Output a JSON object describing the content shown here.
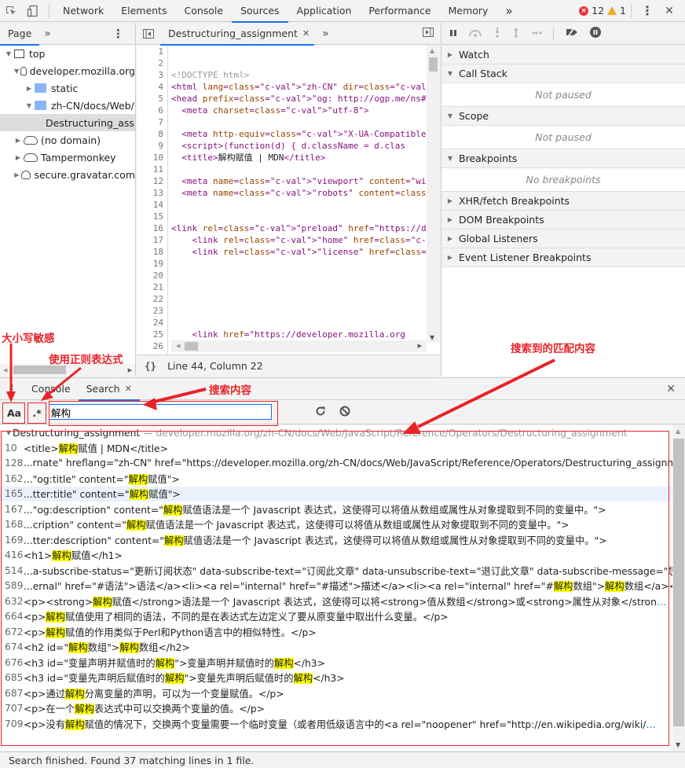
{
  "toolbar": {
    "tabs": [
      "Network",
      "Elements",
      "Console",
      "Sources",
      "Application",
      "Performance",
      "Memory"
    ],
    "active_tab": "Sources",
    "more_tabs_label": "»",
    "error_count": "12",
    "warning_count": "1",
    "close_label": "✕",
    "menu_label": "⋮"
  },
  "navigator": {
    "tab_label": "Page",
    "more_label": "»",
    "menu_label": "⋮",
    "tree": [
      {
        "label": "top",
        "icon": "frame-icon",
        "expanded": true
      },
      {
        "label": "developer.mozilla.org",
        "icon": "cloud-icon",
        "expanded": true
      },
      {
        "label": "static",
        "icon": "folder-icon",
        "expanded": false
      },
      {
        "label": "zh-CN/docs/Web/",
        "icon": "folder-icon",
        "expanded": true
      },
      {
        "label": "Destructuring_assignment",
        "icon": "file-icon",
        "selected": true
      },
      {
        "label": "(no domain)",
        "icon": "cloud-icon",
        "expanded": false
      },
      {
        "label": "Tampermonkey",
        "icon": "cloud-icon",
        "expanded": false
      },
      {
        "label": "secure.gravatar.com",
        "icon": "cloud-icon",
        "expanded": false
      }
    ]
  },
  "editor": {
    "tab_label": "Destructuring_assignment",
    "tab_close": "✕",
    "more_label": "»",
    "line_numbers": [
      "1",
      "2",
      "3",
      "4",
      "5",
      "6",
      "7",
      "8",
      "9",
      "10",
      "11",
      "12",
      "13",
      "14",
      "15",
      "16",
      "17",
      "18",
      "19",
      "20",
      "21",
      "22",
      "23",
      "24",
      "25",
      "26"
    ],
    "lines": [
      "",
      "",
      "<!DOCTYPE html>",
      "<html lang=\"zh-CN\" dir=\"ltr\" class=\"no-js\">",
      "<head prefix=\"og: http://ogp.me/ns#\">",
      "  <meta charset=\"utf-8\">",
      "",
      "  <meta http-equiv=\"X-UA-Compatible\" content=",
      "  <script>(function(d) { d.className = d.clas",
      "  <title>解构赋值 | MDN</title>",
      "",
      "  <meta name=\"viewport\" content=\"width=device",
      "  <meta name=\"robots\" content=\"index, follow\"",
      "",
      "",
      "<link rel=\"preload\" href=\"https://developer.m",
      "    <link rel=\"home\" href=\"/zh-CN/\">",
      "    <link rel=\"license\" href=\"#license\">",
      "",
      "",
      "",
      "",
      "",
      "",
      "    <link href=\"https://developer.mozilla.org",
      ""
    ],
    "status": "Line 44, Column 22",
    "format_label": "{}"
  },
  "debugger": {
    "sections": [
      {
        "label": "Watch",
        "expanded": false
      },
      {
        "label": "Call Stack",
        "expanded": true,
        "empty_text": "Not paused"
      },
      {
        "label": "Scope",
        "expanded": true,
        "empty_text": "Not paused"
      },
      {
        "label": "Breakpoints",
        "expanded": true,
        "empty_text": "No breakpoints"
      },
      {
        "label": "XHR/fetch Breakpoints",
        "expanded": false
      },
      {
        "label": "DOM Breakpoints",
        "expanded": false
      },
      {
        "label": "Global Listeners",
        "expanded": false
      },
      {
        "label": "Event Listener Breakpoints",
        "expanded": false
      }
    ]
  },
  "drawer": {
    "tabs": [
      "Console",
      "Search"
    ],
    "active_tab": "Search",
    "tab_close": "✕",
    "close_label": "✕",
    "drawer_menu": "⋮"
  },
  "search": {
    "case_label": "Aa",
    "regex_label": ".*",
    "query": "解构",
    "refresh_label": "↻",
    "clear_label": "⊘",
    "file_name": "Destructuring_assignment",
    "file_path": "— developer.mozilla.org/zh-CN/docs/Web/JavaScript/Reference/Operators/Destructuring_assignment",
    "results": [
      {
        "line": "10",
        "parts": [
          "<title>",
          "#解构",
          "赋值 | MDN</title>"
        ]
      },
      {
        "line": "128",
        "parts": [
          "...rnate\" hreflang=\"zh-CN\" href=\"https://developer.mozilla.org/zh-CN/docs/Web/JavaScript/Reference/Operators/Destructuring_assignme"
        ],
        "ellipsis": true
      },
      {
        "line": "162",
        "parts": [
          "...\"og:title\" content=\"",
          "#解构",
          "赋值\">"
        ]
      },
      {
        "line": "165",
        "parts": [
          "...tter:title\" content=\"",
          "#解构",
          "赋值\">"
        ],
        "highlighted": true
      },
      {
        "line": "167",
        "parts": [
          "...\"og:description\" content=\"",
          "#解构",
          "赋值语法是一个 Javascript 表达式，这使得可以将值从数组或属性从对象提取到不同的变量中。\">"
        ]
      },
      {
        "line": "168",
        "parts": [
          "...cription\" content=\"",
          "#解构",
          "赋值语法是一个 Javascript 表达式，这使得可以将值从数组或属性从对象提取到不同的变量中。\">"
        ]
      },
      {
        "line": "169",
        "parts": [
          "...tter:description\" content=\"",
          "#解构",
          "赋值语法是一个 Javascript 表达式，这使得可以将值从数组或属性从对象提取到不同的变量中。\">"
        ]
      },
      {
        "line": "416",
        "parts": [
          "<h1>",
          "#解构",
          "赋值</h1>"
        ]
      },
      {
        "line": "514",
        "parts": [
          "...a-subscribe-status=\"更新订阅状态\" data-subscribe-text=\"订阅此文章\" data-unsubscribe-text=\"退订此文章\" data-subscribe-message=\"您"
        ],
        "ellipsis": true
      },
      {
        "line": "589",
        "parts": [
          "...ernal\" href=\"#语法\">语法</a><li><a rel=\"internal\" href=\"#描述\">描述</a><li><a rel=\"internal\" href=\"#",
          "#解构",
          "数组\">",
          "#解构",
          "数组</a><li>"
        ],
        "ellipsis": true
      },
      {
        "line": "632",
        "parts": [
          "<p><strong>",
          "#解构",
          "赋值</strong>语法是一个 Javascript 表达式，这使得可以将<strong>值从数组</strong>或<strong>属性从对象</stron"
        ],
        "ellipsis": true
      },
      {
        "line": "664",
        "parts": [
          "<p>",
          "#解构",
          "赋值使用了相同的语法，不同的是在表达式左边定义了要从原变量中取出什么变量。</p>"
        ]
      },
      {
        "line": "672",
        "parts": [
          "<p>",
          "#解构",
          "赋值的作用类似于Perl和Python语言中的相似特性。</p>"
        ]
      },
      {
        "line": "674",
        "parts": [
          "<h2 id=\"",
          "#解构",
          "数组\">",
          "#解构",
          "数组</h2>"
        ]
      },
      {
        "line": "676",
        "parts": [
          "<h3 id=\"变量声明并赋值时的",
          "#解构",
          "\">变量声明并赋值时的",
          "#解构",
          "</h3>"
        ]
      },
      {
        "line": "685",
        "parts": [
          "<h3 id=\"变量先声明后赋值时的",
          "#解构",
          "\">变量先声明后赋值时的",
          "#解构",
          "</h3>"
        ]
      },
      {
        "line": "687",
        "parts": [
          "<p>通过",
          "#解构",
          "分离变量的声明，可以为一个变量赋值。</p>"
        ]
      },
      {
        "line": "707",
        "parts": [
          "<p>在一个",
          "#解构",
          "表达式中可以交换两个变量的值。</p>"
        ]
      },
      {
        "line": "709",
        "parts": [
          "<p>没有",
          "#解构",
          "赋值的情况下，交换两个变量需要一个临时变量（或者用低级语言中的<a rel=\"noopener\" href=\"http://en.wikipedia.org/wiki/"
        ],
        "ellipsis": true
      }
    ],
    "status": "Search finished.  Found 37 matching lines in 1 file."
  },
  "annotations": {
    "case_sensitive": "大小写敏感",
    "use_regex": "使用正则表达式",
    "search_content": "搜索内容",
    "matched_content": "搜索到的匹配内容",
    "color": "#e8232a"
  }
}
